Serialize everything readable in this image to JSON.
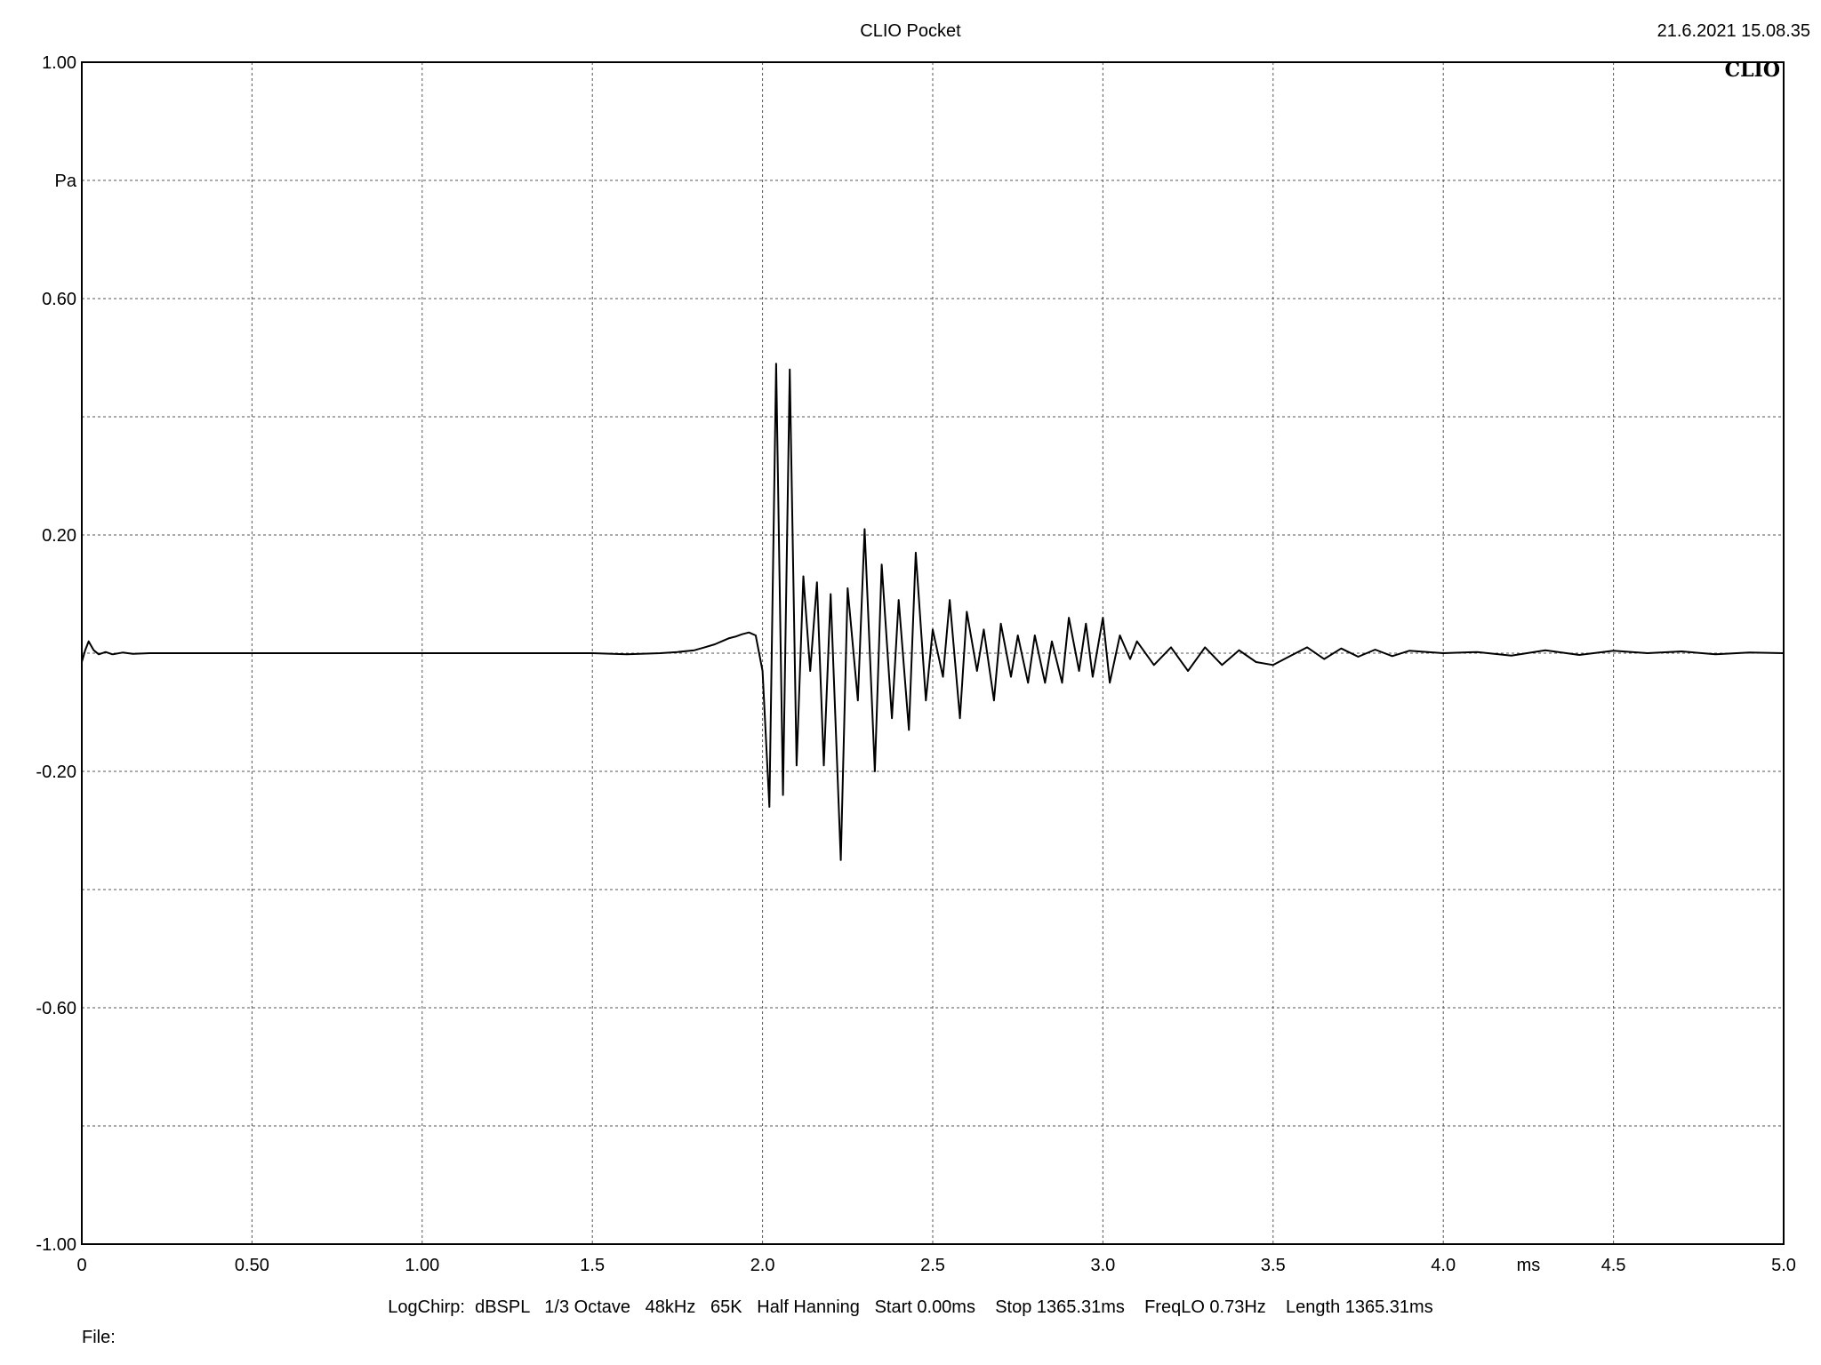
{
  "header": {
    "title": "CLIO Pocket",
    "timestamp": "21.6.2021 15.08.35",
    "logo": "CLIO"
  },
  "footer": {
    "settings": "LogChirp:  dBSPL   1/3 Octave   48kHz   65K   Half Hanning   Start 0.00ms    Stop 1365.31ms    FreqLO 0.73Hz    Length 1365.31ms",
    "file_label": "File:"
  },
  "colors": {
    "trace": "#000000",
    "grid": "#555555",
    "axis": "#000000"
  },
  "chart_data": {
    "type": "line",
    "title": "CLIO Pocket",
    "ylabel": "Pa",
    "xunit": "ms",
    "xlim": [
      0,
      5.0
    ],
    "ylim": [
      -1.0,
      1.0
    ],
    "grid": true,
    "x_ticks": [
      {
        "v": 0,
        "label": "0"
      },
      {
        "v": 0.5,
        "label": "0.50"
      },
      {
        "v": 1.0,
        "label": "1.00"
      },
      {
        "v": 1.5,
        "label": "1.5"
      },
      {
        "v": 2.0,
        "label": "2.0"
      },
      {
        "v": 2.5,
        "label": "2.5"
      },
      {
        "v": 3.0,
        "label": "3.0"
      },
      {
        "v": 3.5,
        "label": "3.5"
      },
      {
        "v": 4.0,
        "label": "4.0"
      },
      {
        "v": 4.5,
        "label": "4.5"
      },
      {
        "v": 5.0,
        "label": "5.0"
      }
    ],
    "y_ticks": [
      {
        "v": 1.0,
        "label": "1.00"
      },
      {
        "v": 0.6,
        "label": "0.60"
      },
      {
        "v": 0.2,
        "label": "0.20"
      },
      {
        "v": -0.2,
        "label": "-0.20"
      },
      {
        "v": -0.6,
        "label": "-0.60"
      },
      {
        "v": -1.0,
        "label": "-1.00"
      }
    ],
    "y_gridlines": [
      1.0,
      0.8,
      0.6,
      0.4,
      0.2,
      0.0,
      -0.2,
      -0.4,
      -0.6,
      -0.8,
      -1.0
    ],
    "series": [
      {
        "x": [
          0,
          0.01,
          0.02,
          0.035,
          0.05,
          0.07,
          0.09,
          0.12,
          0.15,
          0.2,
          0.25,
          0.5,
          1.0,
          1.5,
          1.6,
          1.7,
          1.75,
          1.8,
          1.83,
          1.86,
          1.88,
          1.9,
          1.92,
          1.94,
          1.96,
          1.98,
          2.0,
          2.02,
          2.04,
          2.06,
          2.08,
          2.1,
          2.12,
          2.14,
          2.16,
          2.18,
          2.2,
          2.23,
          2.25,
          2.28,
          2.3,
          2.33,
          2.35,
          2.38,
          2.4,
          2.43,
          2.45,
          2.48,
          2.5,
          2.53,
          2.55,
          2.58,
          2.6,
          2.63,
          2.65,
          2.68,
          2.7,
          2.73,
          2.75,
          2.78,
          2.8,
          2.83,
          2.85,
          2.88,
          2.9,
          2.93,
          2.95,
          2.97,
          3.0,
          3.02,
          3.05,
          3.08,
          3.1,
          3.15,
          3.2,
          3.25,
          3.3,
          3.35,
          3.4,
          3.45,
          3.5,
          3.55,
          3.6,
          3.65,
          3.7,
          3.75,
          3.8,
          3.85,
          3.9,
          4.0,
          4.1,
          4.2,
          4.3,
          4.4,
          4.5,
          4.6,
          4.7,
          4.8,
          4.9,
          5.0
        ],
        "y": [
          -0.015,
          0.005,
          0.02,
          0.005,
          -0.002,
          0.002,
          -0.002,
          0.001,
          -0.001,
          0.0,
          0.0,
          0.0,
          0.0,
          0.0,
          -0.002,
          0.0,
          0.002,
          0.005,
          0.01,
          0.015,
          0.02,
          0.025,
          0.028,
          0.032,
          0.035,
          0.03,
          -0.03,
          -0.26,
          0.49,
          -0.24,
          0.48,
          -0.19,
          0.13,
          -0.03,
          0.12,
          -0.19,
          0.1,
          -0.35,
          0.11,
          -0.08,
          0.21,
          -0.2,
          0.15,
          -0.11,
          0.09,
          -0.13,
          0.17,
          -0.08,
          0.04,
          -0.04,
          0.09,
          -0.11,
          0.07,
          -0.03,
          0.04,
          -0.08,
          0.05,
          -0.04,
          0.03,
          -0.05,
          0.03,
          -0.05,
          0.02,
          -0.05,
          0.06,
          -0.03,
          0.05,
          -0.04,
          0.06,
          -0.05,
          0.03,
          -0.01,
          0.02,
          -0.02,
          0.01,
          -0.03,
          0.01,
          -0.02,
          0.005,
          -0.015,
          -0.02,
          -0.005,
          0.01,
          -0.01,
          0.008,
          -0.006,
          0.006,
          -0.005,
          0.004,
          0.0,
          0.002,
          -0.004,
          0.005,
          -0.003,
          0.004,
          0.0,
          0.003,
          -0.002,
          0.001,
          0.0
        ]
      }
    ]
  }
}
